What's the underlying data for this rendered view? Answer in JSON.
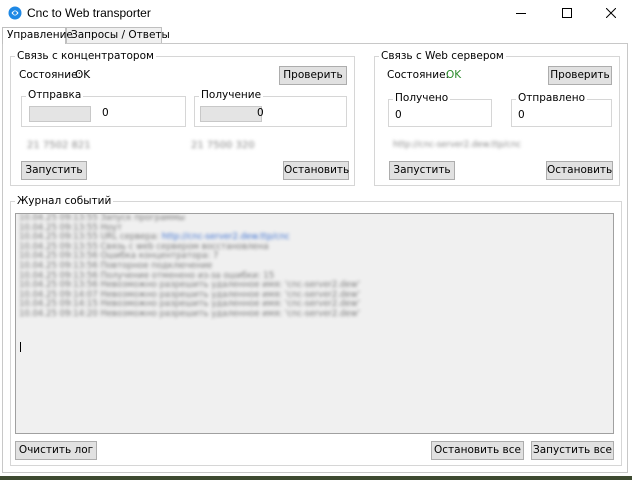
{
  "window": {
    "title": "Cnc to Web transporter"
  },
  "tabs": [
    {
      "label": "Управление",
      "active": true
    },
    {
      "label": "Запросы / Ответы",
      "active": false
    }
  ],
  "concentrator": {
    "legend": "Связь с концентратором",
    "status_label": "Состояние:",
    "status_value": "OK",
    "check_button": "Проверить",
    "sent": {
      "label": "Отправка",
      "value": "0"
    },
    "received": {
      "label": "Получение",
      "value": "0"
    },
    "info_left": "21 7502 821",
    "info_right": "21 7500 320",
    "start_button": "Запустить",
    "stop_button": "Остановить"
  },
  "webserver": {
    "legend": "Связь с Web сервером",
    "status_label": "Состояние:",
    "status_value": "OK",
    "status_color": "#2a8a2a",
    "check_button": "Проверить",
    "received": {
      "label": "Получено",
      "value": "0"
    },
    "sent": {
      "label": "Отправлено",
      "value": "0"
    },
    "url": "http://cnc-server2.dew.ttp/cnc",
    "start_button": "Запустить",
    "stop_button": "Остановить"
  },
  "journal": {
    "legend": "Журнал событий",
    "lines": [
      {
        "ts": "10.04.25 09:13:55",
        "text": "Запуск программы"
      },
      {
        "ts": "10.04.25 09:13:55",
        "text": "Ноут"
      },
      {
        "ts": "10.04.25 09:13:55",
        "text": "URL сервера:",
        "link": "http://cnc-server2.dew.ttp/cnc"
      },
      {
        "ts": "10.04.25 09:13:55",
        "text": "Связь с web сервером восстановлена"
      },
      {
        "ts": "10.04.25 09:13:56",
        "text": "Ошибка концентратора: 7"
      },
      {
        "ts": "10.04.25 09:13:56",
        "text": "Повторное подключение"
      },
      {
        "ts": "10.04.25 09:13:56",
        "text": "Получение отменено из-за ошибки: 15"
      },
      {
        "ts": "10.04.25 09:13:56",
        "text": "Невозможно разрешить удаленное имя: 'cnc-server2.dew'"
      },
      {
        "ts": "10.04.25 09:14:07",
        "text": "Невозможно разрешить удаленное имя: 'cnc-server2.dew'"
      },
      {
        "ts": "10.04.25 09:14:15",
        "text": "Невозможно разрешить удаленное имя: 'cnc-server2.dew'"
      },
      {
        "ts": "10.04.25 09:14:20",
        "text": "Невозможно разрешить удаленное имя: 'cnc-server2.dew'"
      }
    ]
  },
  "footer": {
    "clear_button": "Очистить лог",
    "stop_all_button": "Остановить все",
    "start_all_button": "Запустить все"
  }
}
